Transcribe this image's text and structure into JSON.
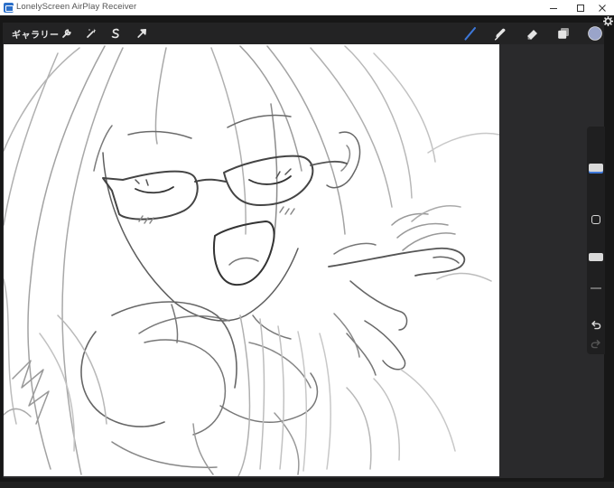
{
  "window": {
    "title": "LonelyScreen AirPlay Receiver",
    "app_icon": "lonelyscreen-app-icon",
    "controls": [
      "minimize-icon",
      "maximize-icon",
      "close-icon"
    ]
  },
  "receiver": {
    "settings_icon": "gear-icon"
  },
  "procreate": {
    "toolbar": {
      "gallery_label": "ギャラリー",
      "left_tools": [
        "wrench-icon",
        "magic-wand-icon",
        "selection-s-icon",
        "transform-arrow-icon"
      ],
      "right_tools": [
        "brush-icon",
        "smudge-icon",
        "eraser-icon",
        "layers-icon",
        "color-swatch"
      ],
      "active_tool": "brush-icon",
      "accent_color": "#3d77d8",
      "current_color": "#9aa4c9"
    },
    "sidebar": {
      "brush_size_level": 0.6,
      "brush_opacity_level": 0.3,
      "buttons": [
        "modify-square-icon",
        "undo-icon",
        "redo-icon"
      ]
    },
    "canvas": {
      "background": "#ffffff",
      "content": "pencil-sketch-artwork"
    }
  }
}
